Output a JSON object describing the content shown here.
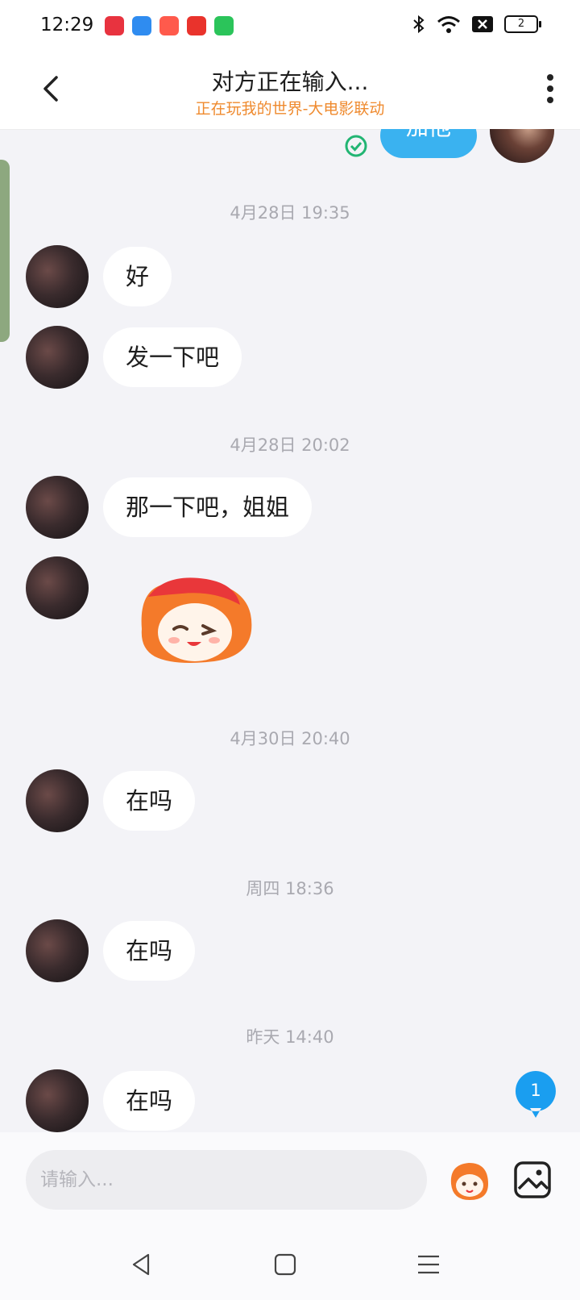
{
  "status_bar": {
    "time": "12:29",
    "app_icons": [
      "video-app-icon",
      "browser-app-icon",
      "shop-app-icon",
      "play-app-icon",
      "market-app-icon"
    ],
    "app_icon_colors": [
      "#e8333f",
      "#2f8cf0",
      "#ff5a4c",
      "#e9332c",
      "#2bc45a"
    ],
    "battery": "2"
  },
  "header": {
    "title": "对方正在输入...",
    "subtitle": "正在玩我的世界-大电影联动"
  },
  "chat": {
    "sent_bubble_text": "加他",
    "timestamps": [
      "4月28日 19:35",
      "4月28日 20:02",
      "4月30日 20:40",
      "周四 18:36",
      "昨天 14:40"
    ],
    "messages": [
      "好",
      "发一下吧",
      "那一下吧，姐姐",
      "在吗",
      "在吗",
      "在吗"
    ],
    "unread_count": "1"
  },
  "input": {
    "placeholder": "请输入..."
  },
  "colors": {
    "accent_blue": "#3ab2f0",
    "subtitle_orange": "#ef8a2e",
    "read_green": "#22b573",
    "background": "#f3f3f7"
  }
}
